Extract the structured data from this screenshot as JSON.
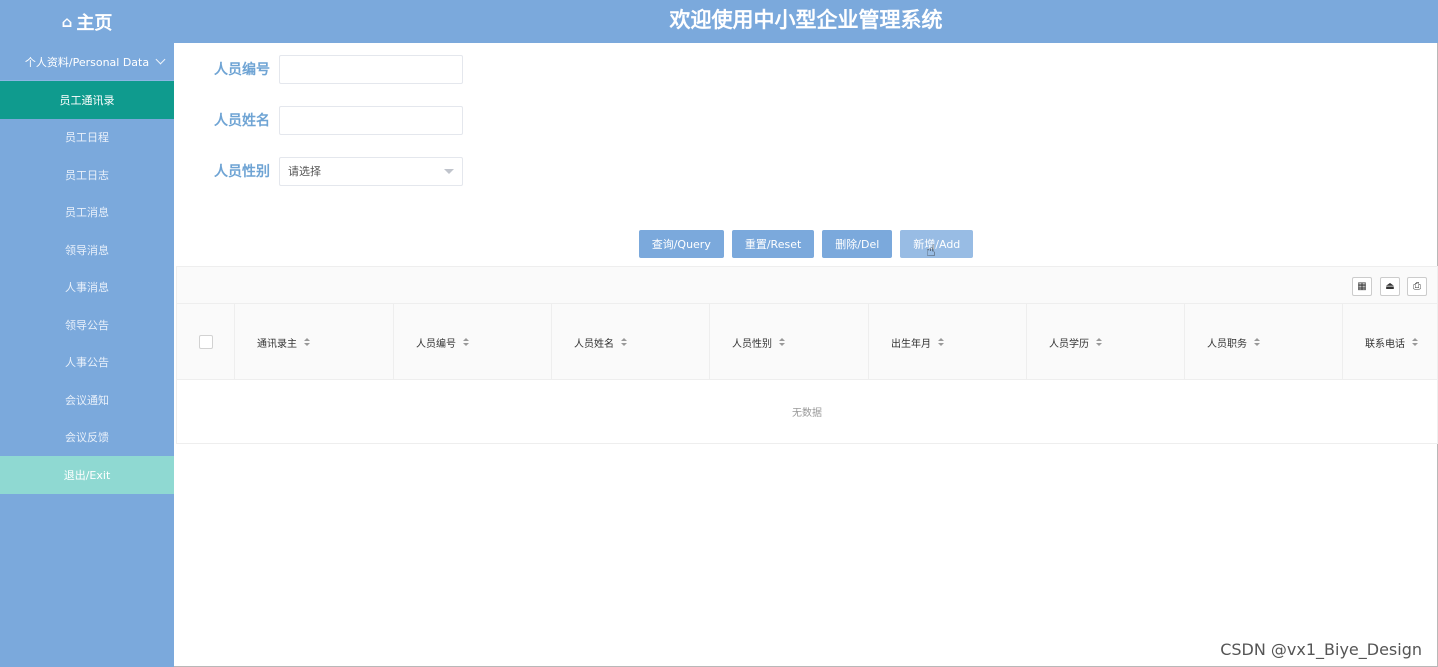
{
  "header": {
    "home_icon": "house-icon",
    "home_label": "主页",
    "title": "欢迎使用中小型企业管理系统"
  },
  "sidebar": {
    "group_label": "个人资料/Personal Data",
    "items": [
      {
        "label": "员工通讯录",
        "active": true
      },
      {
        "label": "员工日程"
      },
      {
        "label": "员工日志"
      },
      {
        "label": "员工消息"
      },
      {
        "label": "领导消息"
      },
      {
        "label": "人事消息"
      },
      {
        "label": "领导公告"
      },
      {
        "label": "人事公告"
      },
      {
        "label": "会议通知"
      },
      {
        "label": "会议反馈"
      }
    ],
    "exit_label": "退出/Exit"
  },
  "search": {
    "id_label": "人员编号",
    "id_value": "",
    "name_label": "人员姓名",
    "name_value": "",
    "gender_label": "人员性别",
    "gender_placeholder": "请选择"
  },
  "actions": {
    "query": "查询/Query",
    "reset": "重置/Reset",
    "delete": "删除/Del",
    "add": "新增/Add"
  },
  "table": {
    "toolbar_icons": [
      "columns-icon",
      "export-icon",
      "print-icon"
    ],
    "columns": [
      "通讯录主",
      "人员编号",
      "人员姓名",
      "人员性别",
      "出生年月",
      "人员学历",
      "人员职务",
      "联系电话"
    ],
    "empty_text": "无数据"
  },
  "watermark": "CSDN @vx1_Biye_Design",
  "colors": {
    "primary": "#7ba9dc",
    "active_menu": "#0f9b8e",
    "exit_menu": "#8fd9d2",
    "label_text": "#6fa4d4"
  }
}
